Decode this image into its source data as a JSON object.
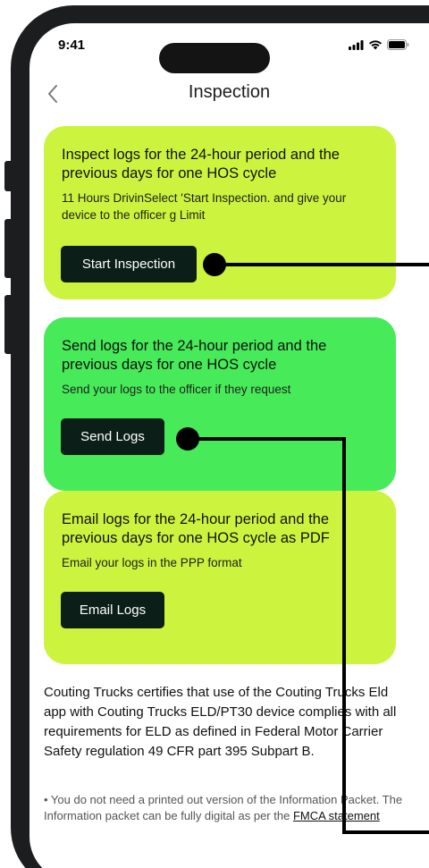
{
  "status_bar": {
    "time": "9:41",
    "icons": [
      "signal-icon",
      "wifi-icon",
      "battery-icon"
    ]
  },
  "nav": {
    "back_icon": "chevron-left-icon",
    "title": "Inspection"
  },
  "cards": [
    {
      "title": "Inspect logs for the 24-hour period and the previous days for one HOS cycle",
      "description": "11 Hours DrivinSelect 'Start Inspection. and give your device to the officer g Limit",
      "button_label": "Start Inspection",
      "background": "#ccf43e"
    },
    {
      "title": "Send logs for the 24-hour period and the previous days for one HOS cycle",
      "description": "Send your logs to the officer if they request",
      "button_label": "Send Logs",
      "background": "#47ea59"
    },
    {
      "title": "Email logs for the 24-hour period and the previous days for one HOS cycle as PDF",
      "description": "Email your logs in the PPP format",
      "button_label": "Email Logs",
      "background": "#ccf43e"
    }
  ],
  "statement": "Couting Trucks certifies that use of the Couting Trucks Eld app with Couting Trucks ELD/PT30 device complies with all requirements for ELD as defined in Federal Motor Carrier Safety regulation 49 CFR part 395 Subpart B.",
  "note": {
    "text": "• You do not need a printed out version of the Information Packet. The Information packet can be fully digital as per the ",
    "link_label": "FMCA statement"
  },
  "colors": {
    "button_bg": "#0b1f18",
    "phone_frame": "#1c1d1f"
  }
}
